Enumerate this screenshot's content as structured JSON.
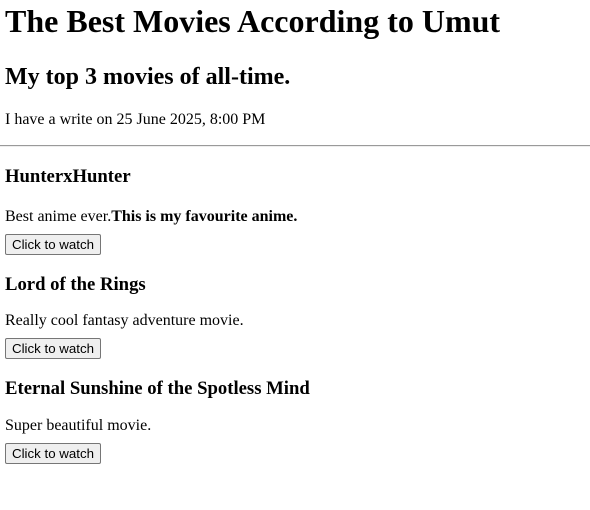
{
  "page": {
    "title": "The Best Movies According to Umut",
    "subtitle": "My top 3 movies of all-time.",
    "date_line": "I have a write on 25 June 2025, 8:00 PM"
  },
  "movies": [
    {
      "name": "HunterxHunter",
      "description": "Best anime ever.",
      "description_bold": "This is my favourite anime.",
      "button_label": "Click to watch"
    },
    {
      "name": "Lord of the Rings",
      "description": "Really cool fantasy adventure movie.",
      "button_label": "Click to watch"
    },
    {
      "name": "Eternal Sunshine of the Spotless Mind",
      "description": "Super beautiful movie.",
      "button_label": "Click to watch"
    }
  ]
}
